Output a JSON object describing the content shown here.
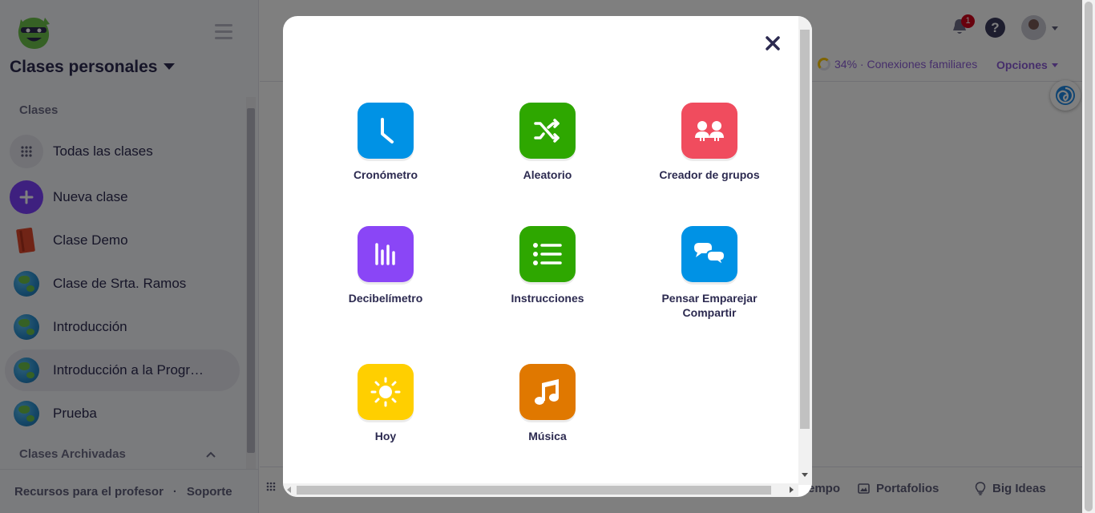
{
  "sidebar": {
    "title": "Clases personales",
    "section_classes": "Clases",
    "items": [
      {
        "label": "Todas las clases"
      },
      {
        "label": "Nueva clase"
      },
      {
        "label": "Clase Demo"
      },
      {
        "label": "Clase de Srta. Ramos"
      },
      {
        "label": "Introducción"
      },
      {
        "label": "Introducción a la Programación"
      },
      {
        "label": "Prueba"
      }
    ],
    "section_archived": "Clases Archivadas",
    "footer": {
      "resources": "Recursos para el profesor",
      "separator": "·",
      "support": "Soporte"
    }
  },
  "topbar": {
    "notification_count": "1",
    "help_label": "?",
    "family_connections": "34% · Conexiones familiares",
    "family_connections_percent": 34,
    "options_label": "Opciones"
  },
  "bottombar": {
    "time_label": "empo",
    "portfolios_label": "Portafolios",
    "big_ideas_label": "Big Ideas"
  },
  "modal": {
    "tools": [
      {
        "label": "Cronómetro",
        "icon": "stopwatch-icon",
        "color": "#0092e5"
      },
      {
        "label": "Aleatorio",
        "icon": "shuffle-icon",
        "color": "#2ea700"
      },
      {
        "label": "Creador de grupos",
        "icon": "group-maker-icon",
        "color": "#f04c5e"
      },
      {
        "label": "Decibelímetro",
        "icon": "noise-meter-icon",
        "color": "#8a46f6"
      },
      {
        "label": "Instrucciones",
        "icon": "directions-list-icon",
        "color": "#2ea700"
      },
      {
        "label": "Pensar Emparejar Compartir",
        "icon": "think-pair-share-icon",
        "color": "#0092e5"
      },
      {
        "label": "Hoy",
        "icon": "sun-icon",
        "color": "#ffcf00"
      },
      {
        "label": "Música",
        "icon": "music-note-icon",
        "color": "#e07800"
      }
    ]
  },
  "colors": {
    "accent": "#8d5dd6",
    "text": "#2c2a50",
    "overlay": "rgba(0,0,0,0.5)"
  }
}
